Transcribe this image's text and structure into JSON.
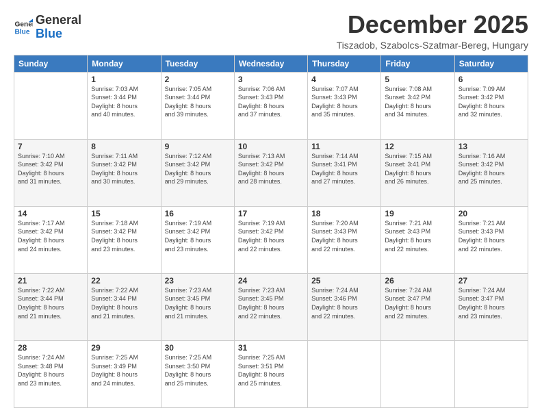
{
  "logo": {
    "line1": "General",
    "line2": "Blue"
  },
  "title": "December 2025",
  "location": "Tiszadob, Szabolcs-Szatmar-Bereg, Hungary",
  "days_header": [
    "Sunday",
    "Monday",
    "Tuesday",
    "Wednesday",
    "Thursday",
    "Friday",
    "Saturday"
  ],
  "weeks": [
    [
      {
        "day": "",
        "info": ""
      },
      {
        "day": "1",
        "info": "Sunrise: 7:03 AM\nSunset: 3:44 PM\nDaylight: 8 hours\nand 40 minutes."
      },
      {
        "day": "2",
        "info": "Sunrise: 7:05 AM\nSunset: 3:44 PM\nDaylight: 8 hours\nand 39 minutes."
      },
      {
        "day": "3",
        "info": "Sunrise: 7:06 AM\nSunset: 3:43 PM\nDaylight: 8 hours\nand 37 minutes."
      },
      {
        "day": "4",
        "info": "Sunrise: 7:07 AM\nSunset: 3:43 PM\nDaylight: 8 hours\nand 35 minutes."
      },
      {
        "day": "5",
        "info": "Sunrise: 7:08 AM\nSunset: 3:42 PM\nDaylight: 8 hours\nand 34 minutes."
      },
      {
        "day": "6",
        "info": "Sunrise: 7:09 AM\nSunset: 3:42 PM\nDaylight: 8 hours\nand 32 minutes."
      }
    ],
    [
      {
        "day": "7",
        "info": "Sunrise: 7:10 AM\nSunset: 3:42 PM\nDaylight: 8 hours\nand 31 minutes."
      },
      {
        "day": "8",
        "info": "Sunrise: 7:11 AM\nSunset: 3:42 PM\nDaylight: 8 hours\nand 30 minutes."
      },
      {
        "day": "9",
        "info": "Sunrise: 7:12 AM\nSunset: 3:42 PM\nDaylight: 8 hours\nand 29 minutes."
      },
      {
        "day": "10",
        "info": "Sunrise: 7:13 AM\nSunset: 3:42 PM\nDaylight: 8 hours\nand 28 minutes."
      },
      {
        "day": "11",
        "info": "Sunrise: 7:14 AM\nSunset: 3:41 PM\nDaylight: 8 hours\nand 27 minutes."
      },
      {
        "day": "12",
        "info": "Sunrise: 7:15 AM\nSunset: 3:41 PM\nDaylight: 8 hours\nand 26 minutes."
      },
      {
        "day": "13",
        "info": "Sunrise: 7:16 AM\nSunset: 3:42 PM\nDaylight: 8 hours\nand 25 minutes."
      }
    ],
    [
      {
        "day": "14",
        "info": "Sunrise: 7:17 AM\nSunset: 3:42 PM\nDaylight: 8 hours\nand 24 minutes."
      },
      {
        "day": "15",
        "info": "Sunrise: 7:18 AM\nSunset: 3:42 PM\nDaylight: 8 hours\nand 23 minutes."
      },
      {
        "day": "16",
        "info": "Sunrise: 7:19 AM\nSunset: 3:42 PM\nDaylight: 8 hours\nand 23 minutes."
      },
      {
        "day": "17",
        "info": "Sunrise: 7:19 AM\nSunset: 3:42 PM\nDaylight: 8 hours\nand 22 minutes."
      },
      {
        "day": "18",
        "info": "Sunrise: 7:20 AM\nSunset: 3:43 PM\nDaylight: 8 hours\nand 22 minutes."
      },
      {
        "day": "19",
        "info": "Sunrise: 7:21 AM\nSunset: 3:43 PM\nDaylight: 8 hours\nand 22 minutes."
      },
      {
        "day": "20",
        "info": "Sunrise: 7:21 AM\nSunset: 3:43 PM\nDaylight: 8 hours\nand 22 minutes."
      }
    ],
    [
      {
        "day": "21",
        "info": "Sunrise: 7:22 AM\nSunset: 3:44 PM\nDaylight: 8 hours\nand 21 minutes."
      },
      {
        "day": "22",
        "info": "Sunrise: 7:22 AM\nSunset: 3:44 PM\nDaylight: 8 hours\nand 21 minutes."
      },
      {
        "day": "23",
        "info": "Sunrise: 7:23 AM\nSunset: 3:45 PM\nDaylight: 8 hours\nand 21 minutes."
      },
      {
        "day": "24",
        "info": "Sunrise: 7:23 AM\nSunset: 3:45 PM\nDaylight: 8 hours\nand 22 minutes."
      },
      {
        "day": "25",
        "info": "Sunrise: 7:24 AM\nSunset: 3:46 PM\nDaylight: 8 hours\nand 22 minutes."
      },
      {
        "day": "26",
        "info": "Sunrise: 7:24 AM\nSunset: 3:47 PM\nDaylight: 8 hours\nand 22 minutes."
      },
      {
        "day": "27",
        "info": "Sunrise: 7:24 AM\nSunset: 3:47 PM\nDaylight: 8 hours\nand 23 minutes."
      }
    ],
    [
      {
        "day": "28",
        "info": "Sunrise: 7:24 AM\nSunset: 3:48 PM\nDaylight: 8 hours\nand 23 minutes."
      },
      {
        "day": "29",
        "info": "Sunrise: 7:25 AM\nSunset: 3:49 PM\nDaylight: 8 hours\nand 24 minutes."
      },
      {
        "day": "30",
        "info": "Sunrise: 7:25 AM\nSunset: 3:50 PM\nDaylight: 8 hours\nand 25 minutes."
      },
      {
        "day": "31",
        "info": "Sunrise: 7:25 AM\nSunset: 3:51 PM\nDaylight: 8 hours\nand 25 minutes."
      },
      {
        "day": "",
        "info": ""
      },
      {
        "day": "",
        "info": ""
      },
      {
        "day": "",
        "info": ""
      }
    ]
  ]
}
